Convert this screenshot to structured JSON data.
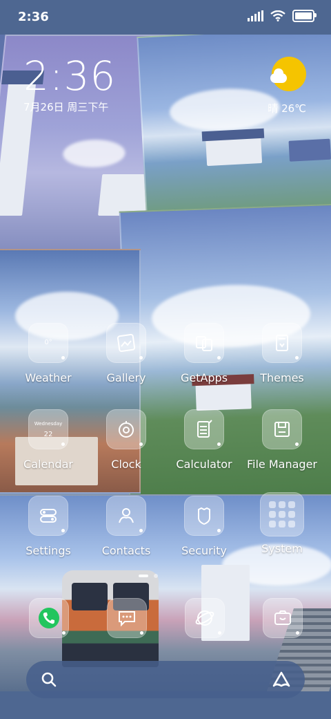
{
  "status_bar": {
    "time": "2:36",
    "battery_level": 0.9
  },
  "clock_widget": {
    "time": "2:36",
    "date": "7月26日 周三下午"
  },
  "weather_widget": {
    "text": "晴 26℃",
    "icon": "sun-cloud-icon"
  },
  "apps": [
    {
      "label": "Weather",
      "icon": "weather-icon",
      "badge": "0°"
    },
    {
      "label": "Gallery",
      "icon": "gallery-icon"
    },
    {
      "label": "GetApps",
      "icon": "getapps-icon"
    },
    {
      "label": "Themes",
      "icon": "themes-icon"
    },
    {
      "label": "Calendar",
      "icon": "calendar-icon",
      "badge_title": "Wednesday",
      "badge_day": "22"
    },
    {
      "label": "Clock",
      "icon": "clock-icon"
    },
    {
      "label": "Calculator",
      "icon": "calculator-icon"
    },
    {
      "label": "File Manager",
      "icon": "file-manager-icon"
    },
    {
      "label": "Settings",
      "icon": "settings-icon"
    },
    {
      "label": "Contacts",
      "icon": "contacts-icon"
    },
    {
      "label": "Security",
      "icon": "security-icon"
    },
    {
      "label": "System",
      "icon": "system-folder-icon"
    }
  ],
  "dock": [
    {
      "icon": "phone-icon"
    },
    {
      "icon": "messages-icon"
    },
    {
      "icon": "browser-icon"
    },
    {
      "icon": "camera-icon"
    }
  ],
  "page_indicator": {
    "pages": 2,
    "current": 1
  },
  "search": {
    "icon": "search-icon",
    "assistant_icon": "assistant-icon"
  }
}
